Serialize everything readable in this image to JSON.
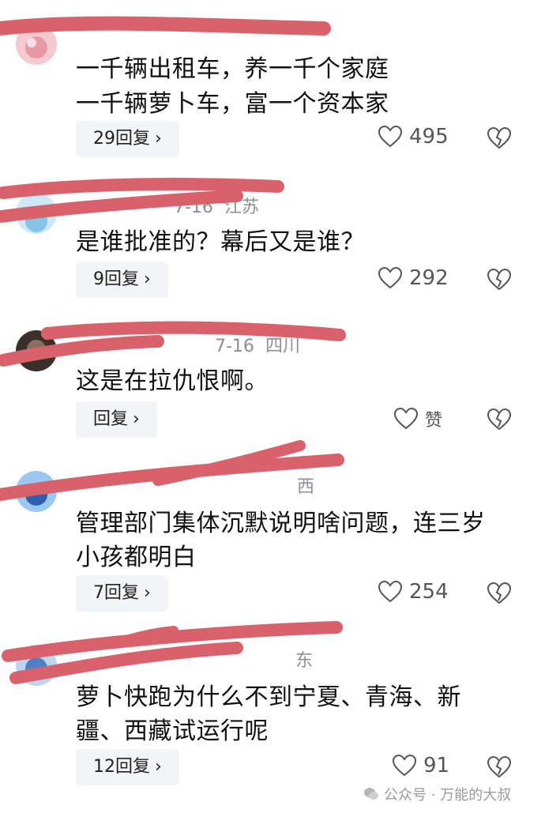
{
  "comments": [
    {
      "meta_name": "",
      "meta_date": "",
      "meta_region": "",
      "lines": [
        "一千辆出租车，养一千个家庭",
        "一千辆萝卜车，富一个资本家"
      ],
      "reply_label": "29回复",
      "like_count": "495"
    },
    {
      "meta_name": "",
      "meta_date": "7-16",
      "meta_region": "江苏",
      "lines": [
        "是谁批准的？幕后又是谁？"
      ],
      "reply_label": "9回复",
      "like_count": "292"
    },
    {
      "meta_name": "",
      "meta_date": "7-16",
      "meta_region": "四川",
      "lines": [
        "这是在拉仇恨啊。"
      ],
      "reply_label": "回复",
      "like_count": "赞"
    },
    {
      "meta_name": "",
      "meta_date": "",
      "meta_region": "西",
      "lines": [
        "管理部门集体沉默说明啥问题，连三岁",
        "小孩都明白"
      ],
      "reply_label": "7回复",
      "like_count": "254"
    },
    {
      "meta_name": "",
      "meta_date": "",
      "meta_region": "东",
      "lines": [
        "萝卜快跑为什么不到宁夏、青海、新",
        "疆、西藏试运行呢"
      ],
      "reply_label": "12回复",
      "like_count": "91"
    }
  ],
  "icons": {
    "like": "heart-outline-icon",
    "dislike": "broken-heart-icon",
    "reply_chevron": "chevron-right-icon",
    "watermark": "wechat-icon"
  },
  "colors": {
    "scribble": "#d9616b",
    "reply_bg": "#f3f4f6",
    "text": "#111111",
    "meta": "#8e8e93"
  },
  "watermark": {
    "text": "公众号 · 万能的大叔"
  }
}
